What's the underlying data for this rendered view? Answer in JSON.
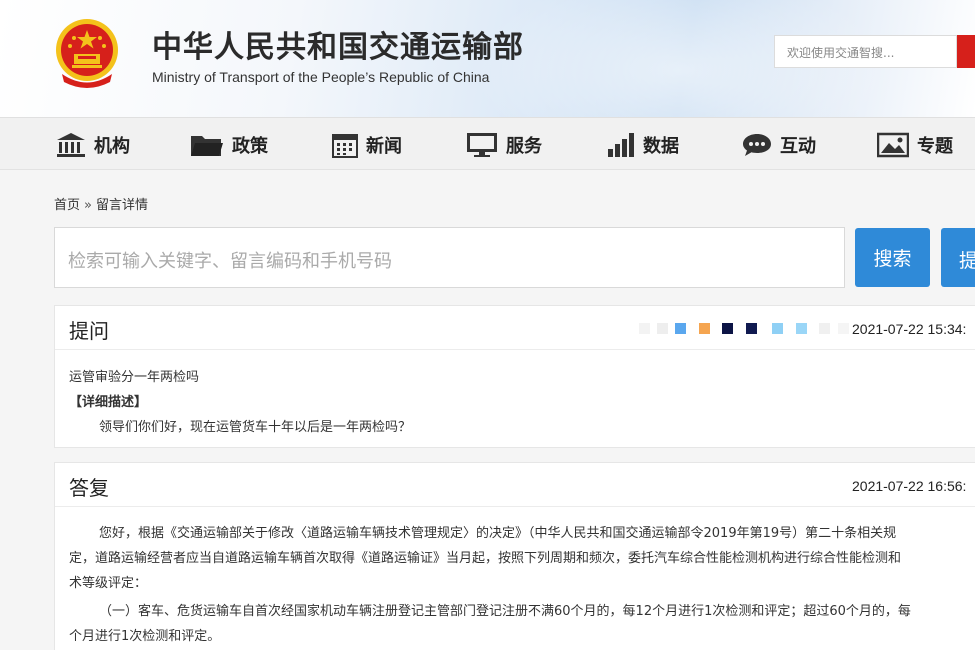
{
  "header": {
    "title_cn": "中华人民共和国交通运输部",
    "title_en": "Ministry of Transport of the People’s Republic of China",
    "search_placeholder": "欢迎使用交通智搜..."
  },
  "nav": {
    "items": [
      {
        "label": "机构",
        "icon": "building-icon"
      },
      {
        "label": "政策",
        "icon": "folder-icon"
      },
      {
        "label": "新闻",
        "icon": "calendar-icon"
      },
      {
        "label": "服务",
        "icon": "monitor-icon"
      },
      {
        "label": "数据",
        "icon": "bar-chart-icon"
      },
      {
        "label": "互动",
        "icon": "chat-icon"
      },
      {
        "label": "专题",
        "icon": "image-icon"
      }
    ]
  },
  "breadcrumb": {
    "home": "首页",
    "separator": "»",
    "current": "留言详情"
  },
  "search": {
    "placeholder": "检索可输入关键字、留言编码和手机号码",
    "button": "搜索",
    "button2": "提"
  },
  "question": {
    "heading": "提问",
    "time": "2021-07-22 15:34:",
    "title": "运管审验分一年两检吗",
    "detail_label": "【详细描述】",
    "detail": "领导们你们好，现在运管货车十年以后是一年两检吗？"
  },
  "answer": {
    "heading": "答复",
    "time": "2021-07-22 16:56:",
    "lines": [
      "您好，根据《交通运输部关于修改〈道路运输车辆技术管理规定〉的决定》（中华人民共和国交通运输部令2019年第19号）第二十条相关规",
      "定，道路运输经营者应当自道路运输车辆首次取得《道路运输证》当月起，按照下列周期和频次，委托汽车综合性能检测机构进行综合性能检测和",
      "术等级评定：",
      "（一）客车、危货运输车自首次经国家机动车辆注册登记主管部门登记注册不满60个月的，每12个月进行1次检测和评定；超过60个月的，每",
      "个月进行1次检测和评定。"
    ]
  },
  "colors": {
    "accent": "#2f8ad8",
    "emblem_red": "#d6201b",
    "emblem_gold": "#f4c21b"
  }
}
